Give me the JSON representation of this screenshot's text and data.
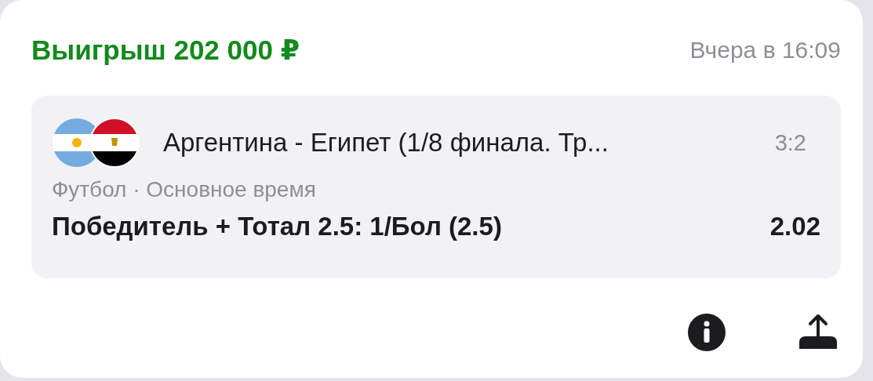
{
  "card": {
    "title": "Выигрыш 202 000 ₽",
    "won": true,
    "time": "Вчера в 16:09"
  },
  "event": {
    "match": "Аргентина - Египет (1/8 финала. Тр...",
    "score": "3:2",
    "meta": "Футбол · Основное время",
    "bet": "Победитель + Тотал 2.5: 1/Бол (2.5)",
    "odds": "2.02"
  }
}
